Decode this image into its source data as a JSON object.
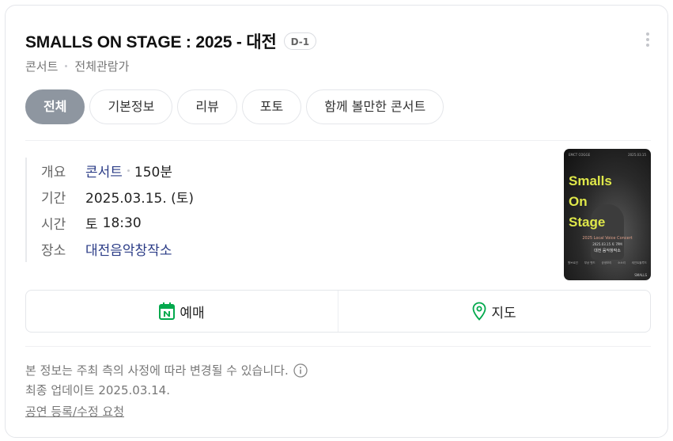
{
  "header": {
    "title": "SMALLS ON STAGE : 2025 - 대전",
    "dday_badge": "D-1",
    "category": "콘서트",
    "rating": "전체관람가"
  },
  "tabs": [
    {
      "label": "전체",
      "active": true
    },
    {
      "label": "기본정보",
      "active": false
    },
    {
      "label": "리뷰",
      "active": false
    },
    {
      "label": "포토",
      "active": false
    },
    {
      "label": "함께 볼만한 콘서트",
      "active": false
    }
  ],
  "info": {
    "overview": {
      "label": "개요",
      "genre": "콘서트",
      "duration": "150분"
    },
    "period": {
      "label": "기간",
      "value": "2025.03.15. (토)"
    },
    "time": {
      "label": "시간",
      "day": "토",
      "value": "18:30"
    },
    "venue": {
      "label": "장소",
      "value": "대전음악창작소"
    }
  },
  "poster": {
    "title_lines": [
      "Smalls",
      "On",
      "Stage"
    ],
    "top_left": "EMCT COGGE",
    "top_right": "2025.03.15",
    "subtitle": "2025 Local Voice Concert",
    "date_line": "2025.03.15 토 7PM",
    "venue_line": "대전 음악창작소",
    "bottom_items": [
      "원브로건",
      "부상 밴드",
      "공생보리",
      "소소리",
      "세인트블루드"
    ],
    "logo": "SMALLS",
    "title_color": "#dfe84a"
  },
  "actions": {
    "reserve_label": "예매",
    "map_label": "지도",
    "reserve_icon": "naver-calendar-icon",
    "map_icon": "map-pin-icon",
    "accent_color": "#03a94d"
  },
  "footer": {
    "notice": "본 정보는 주최 측의 사정에 따라 변경될 수 있습니다.",
    "updated": "최종 업데이트 2025.03.14.",
    "report_link": "공연 등록/수정 요청"
  }
}
